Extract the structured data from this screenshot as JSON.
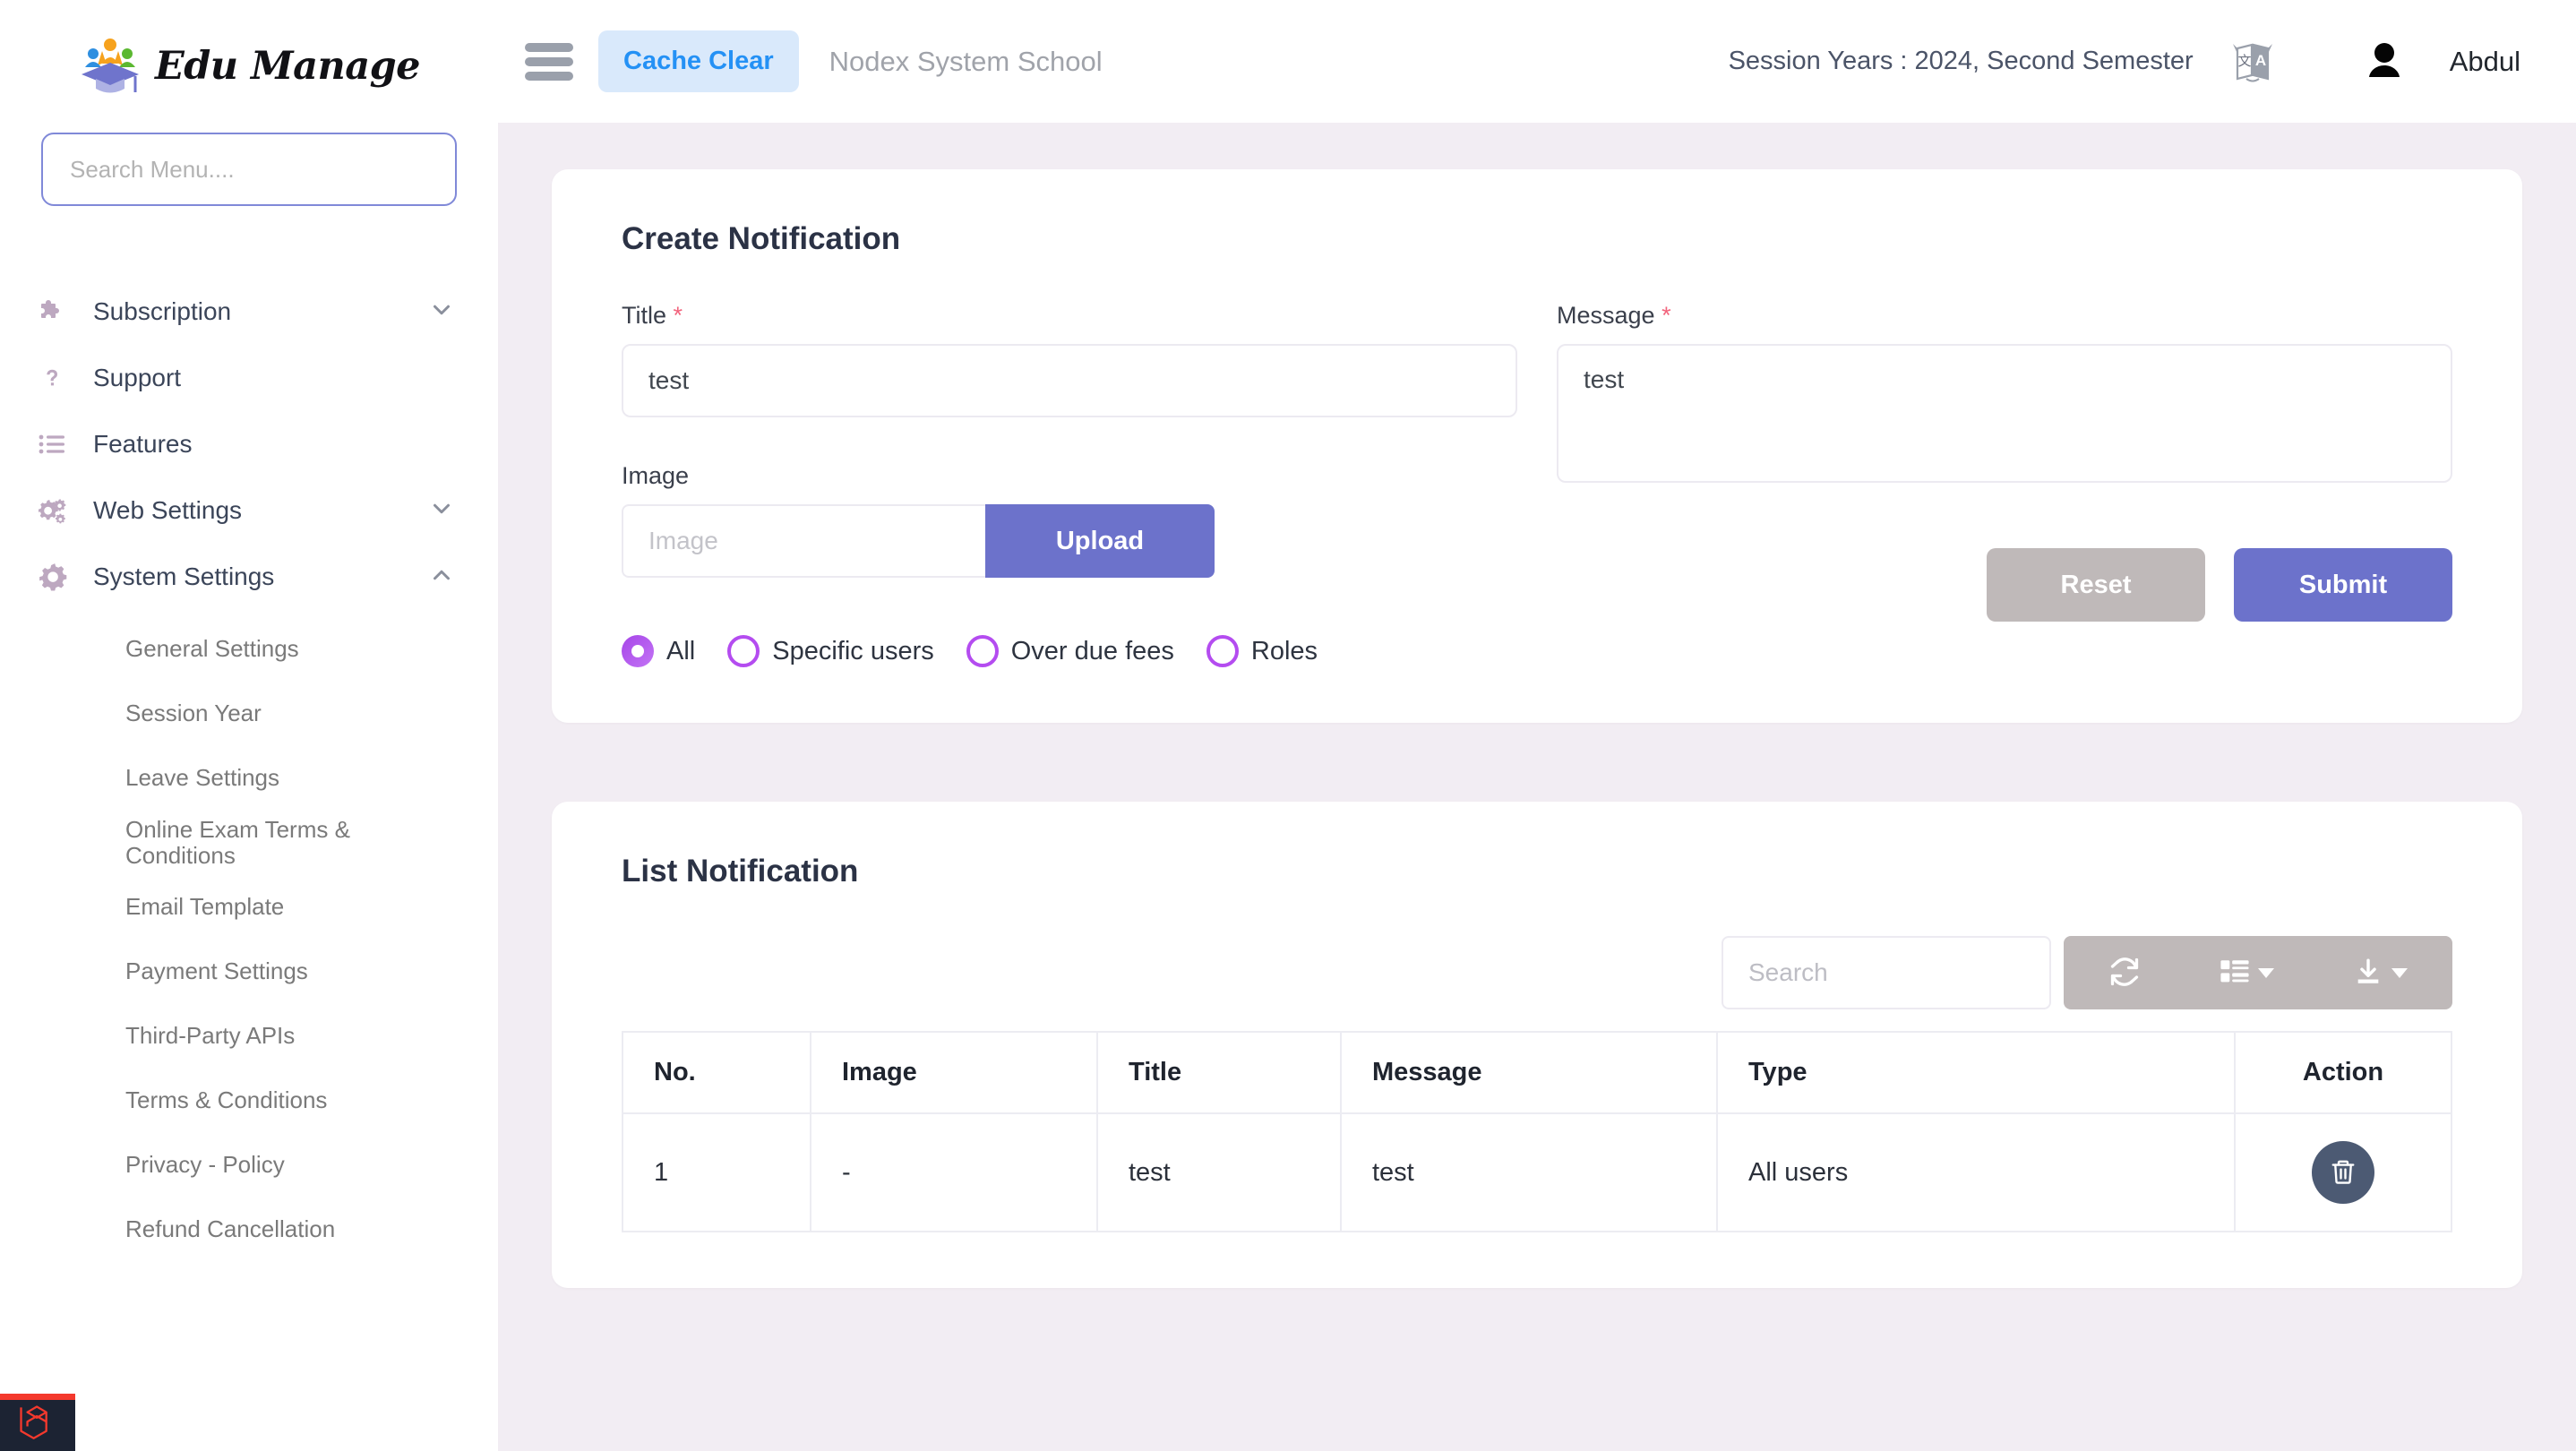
{
  "brand": {
    "name": "Edu Manage",
    "logo_icon": "graduation-cap-logo"
  },
  "sidebar": {
    "search_placeholder": "Search Menu....",
    "items": [
      {
        "label": "Subscription",
        "icon": "puzzle-icon",
        "chevron": "chevron-down-icon"
      },
      {
        "label": "Support",
        "icon": "question-mark-icon",
        "chevron": ""
      },
      {
        "label": "Features",
        "icon": "list-icon",
        "chevron": ""
      },
      {
        "label": "Web Settings",
        "icon": "gears-icon",
        "chevron": "chevron-down-icon"
      },
      {
        "label": "System Settings",
        "icon": "gear-icon",
        "chevron": "chevron-up-icon"
      }
    ],
    "submenu": [
      "General Settings",
      "Session Year",
      "Leave Settings",
      "Online Exam Terms & Conditions",
      "Email Template",
      "Payment Settings",
      "Third-Party APIs",
      "Terms & Conditions",
      "Privacy - Policy",
      "Refund Cancellation"
    ],
    "debugbar_icon": "laravel-logo"
  },
  "topbar": {
    "menu_icon": "hamburger-icon",
    "cache_clear_label": "Cache Clear",
    "school_name": "Nodex System School",
    "session_label": "Session Years : 2024, Second Semester",
    "translate_icon": "translate-icon",
    "avatar_icon": "user-avatar-icon",
    "user_name": "Abdul"
  },
  "create_card": {
    "title": "Create Notification",
    "title_field": {
      "label": "Title",
      "required": "*",
      "value": "test"
    },
    "message_field": {
      "label": "Message",
      "required": "*",
      "value": "test"
    },
    "image_field": {
      "label": "Image",
      "placeholder": "Image",
      "value": "",
      "upload_label": "Upload"
    },
    "recipients": [
      {
        "label": "All",
        "selected": true
      },
      {
        "label": "Specific users",
        "selected": false
      },
      {
        "label": "Over due fees",
        "selected": false
      },
      {
        "label": "Roles",
        "selected": false
      }
    ],
    "reset_label": "Reset",
    "submit_label": "Submit"
  },
  "list_card": {
    "title": "List Notification",
    "search_placeholder": "Search",
    "toolbar": [
      {
        "icon": "refresh-icon",
        "has_caret": false
      },
      {
        "icon": "columns-icon",
        "has_caret": true
      },
      {
        "icon": "export-icon",
        "has_caret": true
      }
    ],
    "columns": [
      "No.",
      "Image",
      "Title",
      "Message",
      "Type",
      "Action"
    ],
    "rows": [
      {
        "no": "1",
        "image": "-",
        "title": "test",
        "message": "test",
        "type": "All users",
        "action_icon": "trash-icon"
      }
    ]
  },
  "colors": {
    "primary": "#6c72cb",
    "accent_purple": "#b44cf0",
    "page_bg": "#f2edf3",
    "muted_btn": "#bfb9b9",
    "cache_blue": "#2491f5",
    "required_red": "#f2647d",
    "delete_slate": "#4c5a73"
  }
}
